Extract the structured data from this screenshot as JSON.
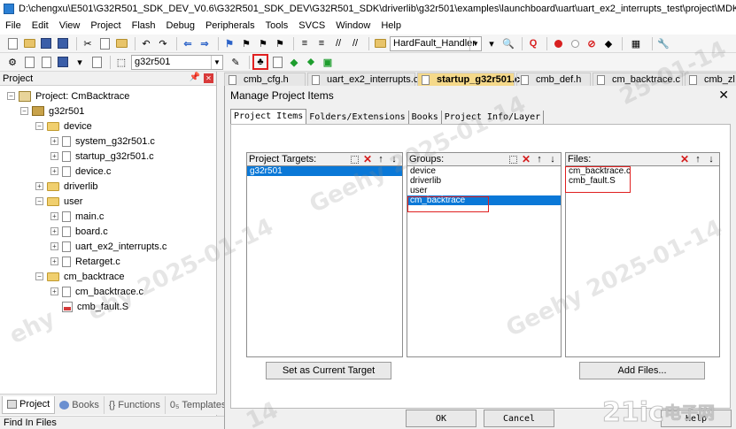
{
  "window": {
    "title": "D:\\chengxu\\E501\\G32R501_SDK_DEV_V0.6\\G32R501_SDK_DEV\\G32R501_SDK\\driverlib\\g32r501\\examples\\launchboard\\uart\\uart_ex2_interrupts_test\\project\\MDK\\CmBacktrace"
  },
  "menu": [
    "File",
    "Edit",
    "View",
    "Project",
    "Flash",
    "Debug",
    "Peripherals",
    "Tools",
    "SVCS",
    "Window",
    "Help"
  ],
  "toolbar": {
    "function_combo": "HardFault_Handler",
    "target_combo": "g32r501"
  },
  "project_panel": {
    "title": "Project",
    "root": "Project: CmBacktrace",
    "target": "g32r501",
    "groups": {
      "device": "device",
      "device_files": [
        "system_g32r501.c",
        "startup_g32r501.c",
        "device.c"
      ],
      "driverlib": "driverlib",
      "user": "user",
      "user_files": [
        "main.c",
        "board.c",
        "uart_ex2_interrupts.c",
        "Retarget.c"
      ],
      "cm_backtrace": "cm_backtrace",
      "cm_files": [
        "cm_backtrace.c",
        "cmb_fault.S"
      ]
    },
    "bottom_tabs": [
      "Project",
      "Books",
      "{} Functions",
      "0₅ Templates"
    ]
  },
  "editor_tabs": [
    "cmb_cfg.h",
    "uart_ex2_interrupts.c",
    "startup_g32r501.c",
    "cmb_def.h",
    "cm_backtrace.c",
    "cmb_zl"
  ],
  "dialog": {
    "title": "Manage Project Items",
    "close": "✕",
    "tabs": [
      "Project Items",
      "Folders/Extensions",
      "Books",
      "Project Info/Layer"
    ],
    "targets": {
      "label": "Project Targets:",
      "items": [
        "g32r501"
      ]
    },
    "groups": {
      "label": "Groups:",
      "items": [
        "device",
        "driverlib",
        "user",
        "cm_backtrace"
      ]
    },
    "files": {
      "label": "Files:",
      "items": [
        "cm_backtrace.c",
        "cmb_fault.S"
      ]
    },
    "buttons": {
      "set_target": "Set as Current Target",
      "add_files": "Add Files...",
      "ok": "OK",
      "cancel": "Cancel",
      "help": "Help"
    }
  },
  "status_bar": "Find In Files",
  "watermark": [
    "Geehy 2025-01-14",
    "ehy 2025-01-14",
    "14",
    "Geehy 2025-01-14",
    "ehy",
    "25-01-14"
  ],
  "logo": {
    "text1": "21ic",
    "text2": "电子网"
  },
  "colors": {
    "selection": "#0a78d7",
    "highlight_box": "#e02020",
    "active_tab": "#f5d98a"
  }
}
